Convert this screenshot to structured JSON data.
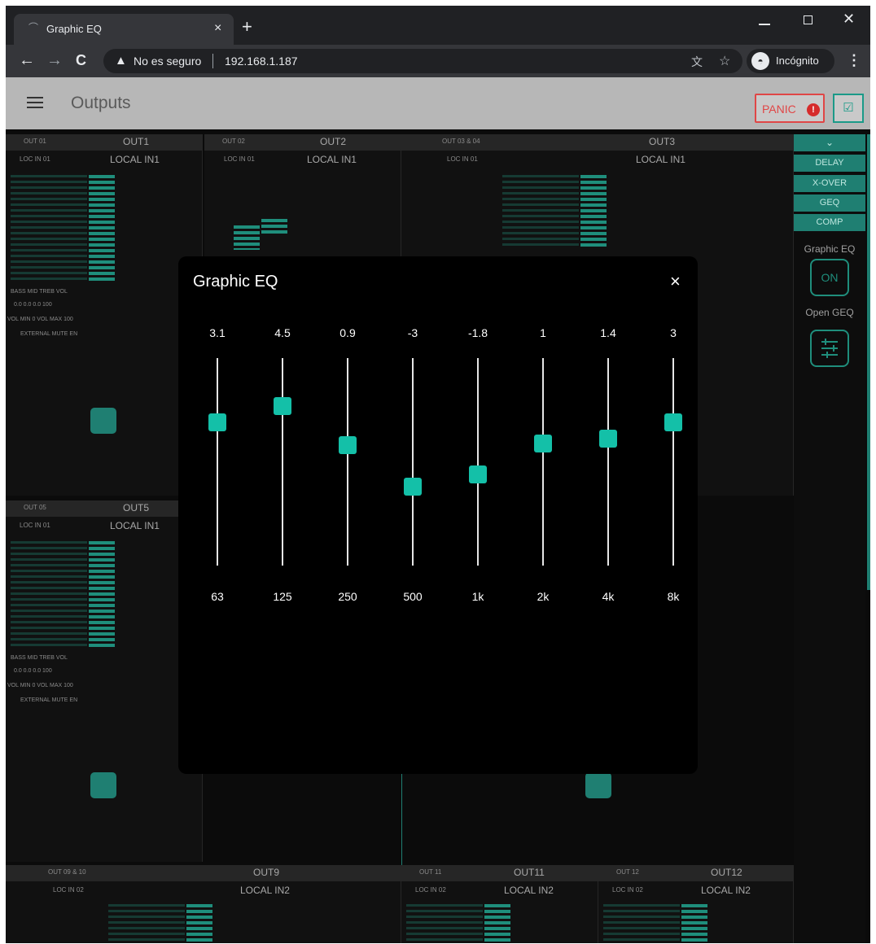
{
  "browser": {
    "tab_title": "Graphic EQ",
    "tab_close": "×",
    "new_tab": "+",
    "window_close": "✕",
    "nav_back": "←",
    "nav_forward": "→",
    "nav_reload": "C",
    "security_text": "No es seguro",
    "url": "192.168.1.187",
    "incognito_label": "Incógnito",
    "menu": "⋮"
  },
  "app": {
    "page_title": "Outputs",
    "panic_label": "PANIC",
    "panic_badge": "!",
    "confirm_icon": "☑"
  },
  "side_panel": {
    "collapse": "⌄",
    "buttons": [
      "DELAY",
      "X-OVER",
      "GEQ",
      "COMP"
    ],
    "graphic_eq_label": "Graphic EQ",
    "graphic_eq_state": "ON",
    "open_geq_label": "Open GEQ"
  },
  "strips": [
    {
      "code": "OUT 01",
      "name": "OUT1",
      "source": "LOC IN 01",
      "input": "LOCAL IN1"
    },
    {
      "code": "OUT 02",
      "name": "OUT2",
      "source": "LOC IN 01",
      "input": "LOCAL IN1"
    },
    {
      "code": "OUT 03 & 04",
      "name": "OUT3",
      "source": "LOC IN 01",
      "input": "LOCAL IN1"
    },
    {
      "code": "OUT 05",
      "name": "OUT5",
      "source": "LOC IN 01",
      "input": "LOCAL IN1"
    },
    {
      "code": "OUT 09 & 10",
      "name": "OUT9",
      "source": "LOC IN 02",
      "input": "LOCAL IN2"
    },
    {
      "code": "OUT 11",
      "name": "OUT11",
      "source": "LOC IN 02",
      "input": "LOCAL IN2"
    },
    {
      "code": "OUT 12",
      "name": "OUT12",
      "source": "LOC IN 02",
      "input": "LOCAL IN2"
    }
  ],
  "strip_controls": {
    "tone_labels": "BASS   MID   TREB   VOL",
    "tone_values": "0.0   0.0   0.0   100",
    "vol_range": "VOL MIN  0  VOL MAX  100",
    "mute": "EXTERNAL MUTE EN"
  },
  "modal": {
    "title": "Graphic EQ",
    "close": "×",
    "range_db": [
      -12,
      12
    ],
    "bands": [
      {
        "freq": "63",
        "gain": "3.1",
        "level": 0.69
      },
      {
        "freq": "125",
        "gain": "4.5",
        "level": 0.77
      },
      {
        "freq": "250",
        "gain": "0.9",
        "level": 0.58
      },
      {
        "freq": "500",
        "gain": "-3",
        "level": 0.38
      },
      {
        "freq": "1k",
        "gain": "-1.8",
        "level": 0.44
      },
      {
        "freq": "2k",
        "gain": "1",
        "level": 0.59
      },
      {
        "freq": "4k",
        "gain": "1.4",
        "level": 0.61
      },
      {
        "freq": "8k",
        "gain": "3",
        "level": 0.69
      }
    ]
  },
  "colors": {
    "accent": "#1f8e7c",
    "thumb": "#14c0a8",
    "panic": "#e04646"
  }
}
